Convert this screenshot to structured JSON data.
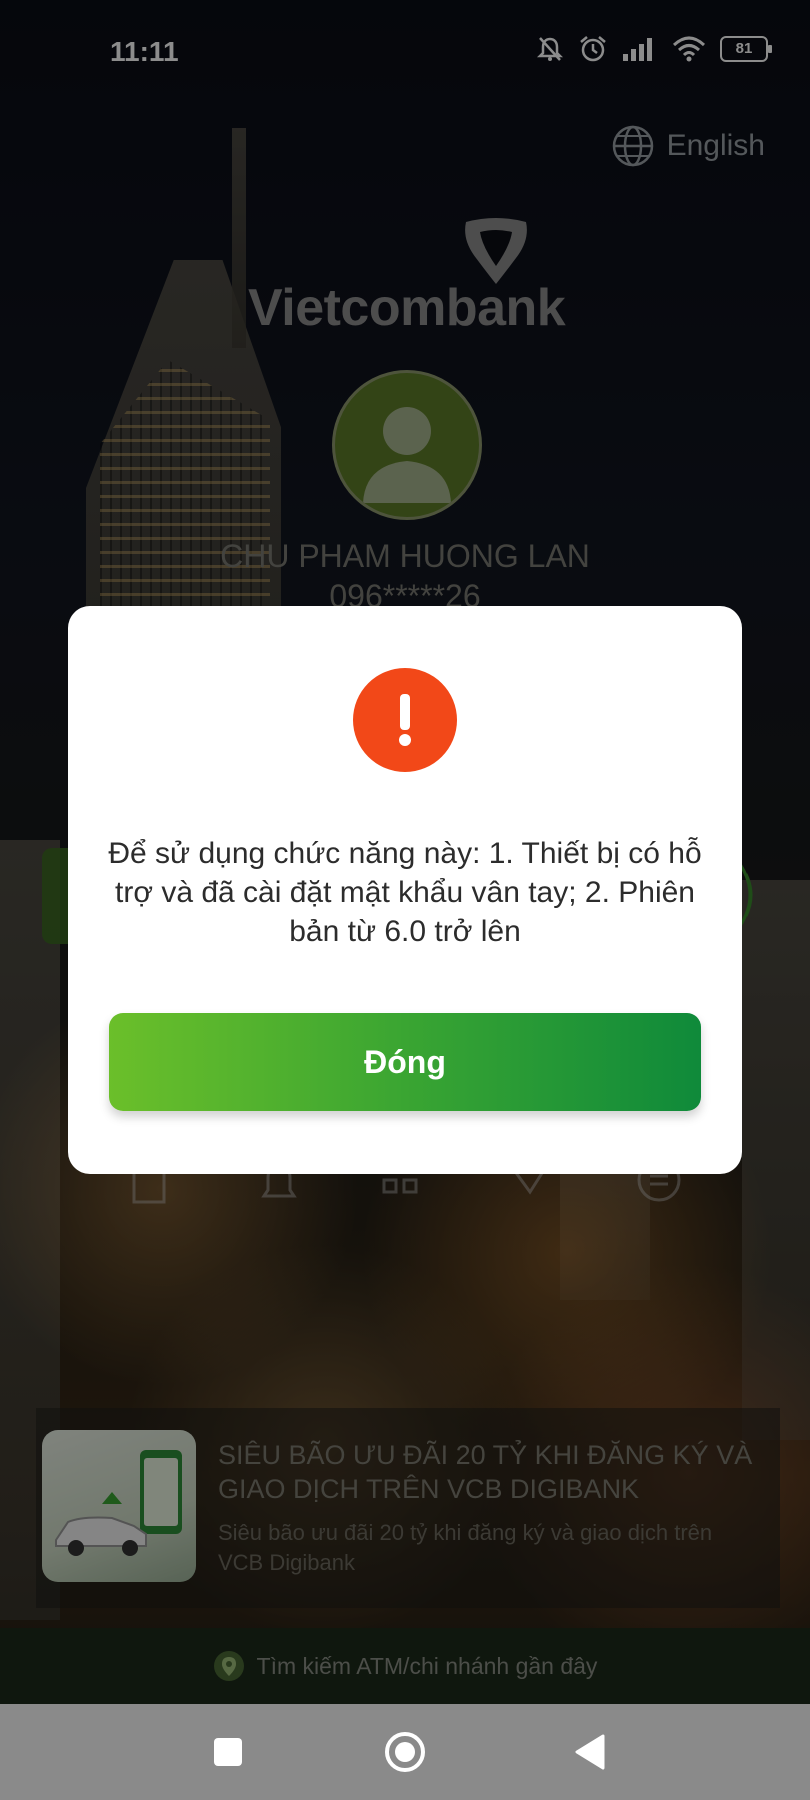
{
  "status_bar": {
    "time": "11:11",
    "battery": "81",
    "icons": [
      "mute-icon",
      "alarm-icon",
      "signal-icon",
      "wifi-icon",
      "battery-icon"
    ]
  },
  "language": {
    "label": "English",
    "icon": "globe-icon"
  },
  "brand": {
    "name": "Vietcombank"
  },
  "user": {
    "name": "CHU PHAM HUONG LAN",
    "phone": "096*****26"
  },
  "dialog": {
    "icon": "alert-icon",
    "icon_color": "#f24818",
    "message": "Để sử dụng chức năng này: 1. Thiết bị có hỗ trợ và đã cài đặt mật khẩu vân tay; 2. Phiên bản từ 6.0 trở lên",
    "button_label": "Đóng"
  },
  "promo": {
    "title": "SIÊU BÃO ƯU ĐÃI 20 TỶ KHI ĐĂNG KÝ VÀ GIAO DỊCH TRÊN VCB DIGIBANK",
    "subtitle": "Siêu bão ưu đãi 20 tỷ khi đăng ký và giao dịch trên VCB Digibank"
  },
  "atm_search": {
    "label": "Tìm kiếm ATM/chi nhánh gần đây",
    "icon": "location-pin-icon"
  },
  "nav": {
    "buttons": [
      "recents-button",
      "home-button",
      "back-button"
    ]
  },
  "colors": {
    "brand_green": "#3aa532",
    "alert_red": "#f24818",
    "nav_bg": "#8a8a8a"
  }
}
